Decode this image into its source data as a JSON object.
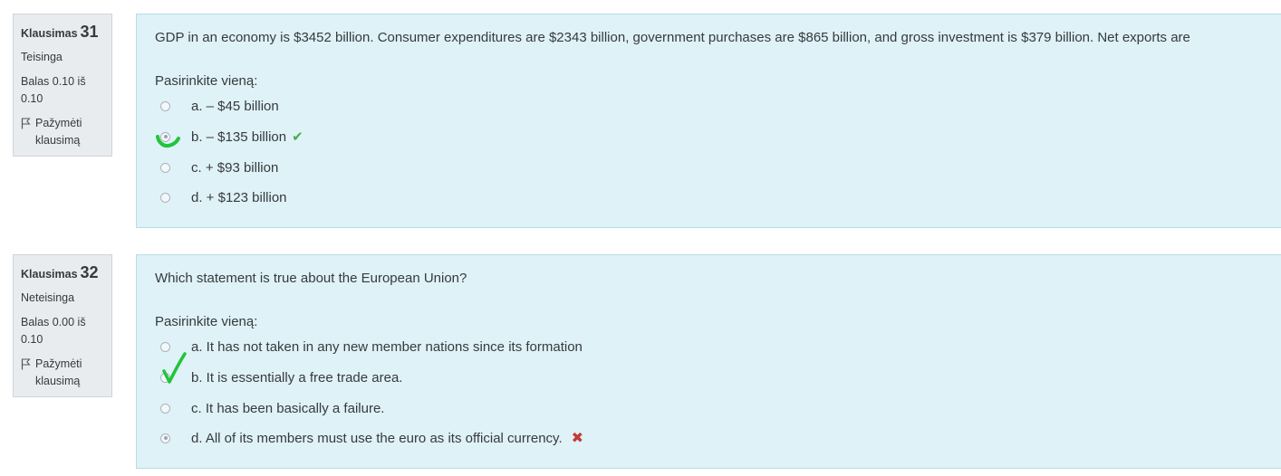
{
  "questions": [
    {
      "label": "Klausimas",
      "number": "31",
      "state": "Teisinga",
      "grade_line1": "Balas 0.10 iš",
      "grade_line2": "0.10",
      "flag_line1": "Pažymėti",
      "flag_line2": "klausimą",
      "text": "GDP in an economy is $3452 billion.  Consumer expenditures are $2343 billion, government purchases are $865 billion, and gross investment is $379 billion.  Net exports are",
      "prompt": "Pasirinkite vieną:",
      "answers": [
        {
          "text": "a. – $45 billion"
        },
        {
          "text": "b. – $135 billion"
        },
        {
          "text": "c. + $93 billion"
        },
        {
          "text": "d. + $123 billion"
        }
      ],
      "selected": "b",
      "feedback_icon": "correct-check-icon"
    },
    {
      "label": "Klausimas",
      "number": "32",
      "state": "Neteisinga",
      "grade_line1": "Balas 0.00 iš",
      "grade_line2": "0.10",
      "flag_line1": "Pažymėti",
      "flag_line2": "klausimą",
      "text": "Which statement is true about the European Union?",
      "prompt": "Pasirinkite vieną:",
      "answers": [
        {
          "text": "a. It has not taken in any new member nations since its formation"
        },
        {
          "text": "b. It is essentially a free trade area."
        },
        {
          "text": "c. It has been basically a failure."
        },
        {
          "text": "d. All of its members must use the euro as its official currency."
        }
      ],
      "selected": "d",
      "feedback_icon": "incorrect-x-icon"
    }
  ],
  "colors": {
    "correct": "#4aab4f",
    "incorrect": "#c23b3b",
    "handwritten_mark": "#22c43a",
    "content_bg": "#def2f8",
    "info_bg": "#e9ecef"
  }
}
